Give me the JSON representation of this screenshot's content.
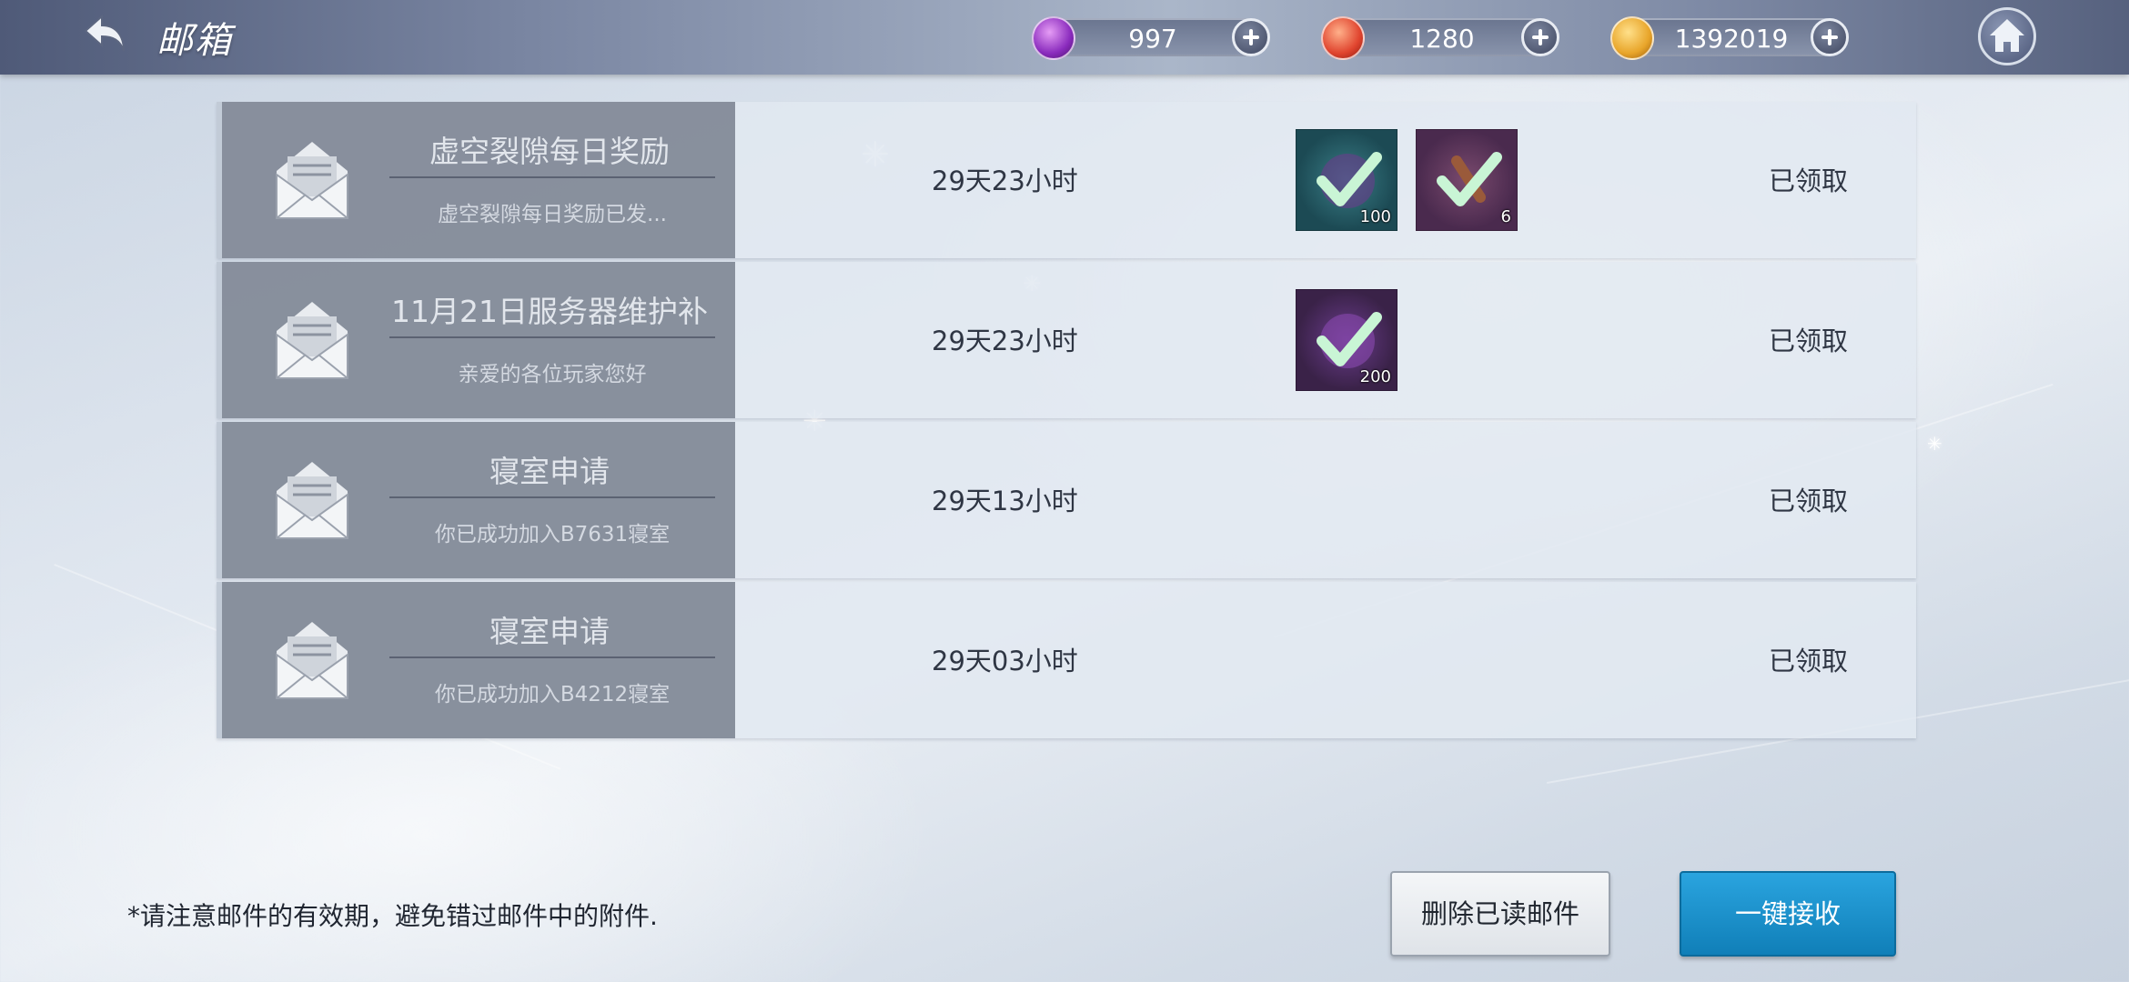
{
  "header": {
    "title": "邮箱",
    "back_icon": "back-arrow-icon",
    "home_icon": "home-icon",
    "currencies": [
      {
        "name": "purple-gem",
        "value": "997",
        "color": "#a44bd6"
      },
      {
        "name": "red-crystal",
        "value": "1280",
        "color": "#e2533a"
      },
      {
        "name": "gold-coin",
        "value": "1392019",
        "color": "#e8a52a"
      }
    ]
  },
  "mails": [
    {
      "title": "虚空裂隙每日奖励",
      "subtitle": "虚空裂隙每日奖励已发...",
      "time_left": "29天23小时",
      "status": "已领取",
      "attachments": [
        {
          "qty": "100",
          "color": "#1c4a54"
        },
        {
          "qty": "6",
          "color": "#4a2a4e"
        }
      ]
    },
    {
      "title": "11月21日服务器维护补",
      "subtitle": "亲爱的各位玩家您好",
      "time_left": "29天23小时",
      "status": "已领取",
      "attachments": [
        {
          "qty": "200",
          "color": "#3a2248"
        }
      ]
    },
    {
      "title": "寝室申请",
      "subtitle": "你已成功加入B7631寝室",
      "time_left": "29天13小时",
      "status": "已领取",
      "attachments": []
    },
    {
      "title": "寝室申请",
      "subtitle": "你已成功加入B4212寝室",
      "time_left": "29天03小时",
      "status": "已领取",
      "attachments": []
    }
  ],
  "footer": {
    "notice": "*请注意邮件的有效期，避免错过邮件中的附件.",
    "delete_label": "删除已读邮件",
    "collect_label": "一键接收"
  }
}
